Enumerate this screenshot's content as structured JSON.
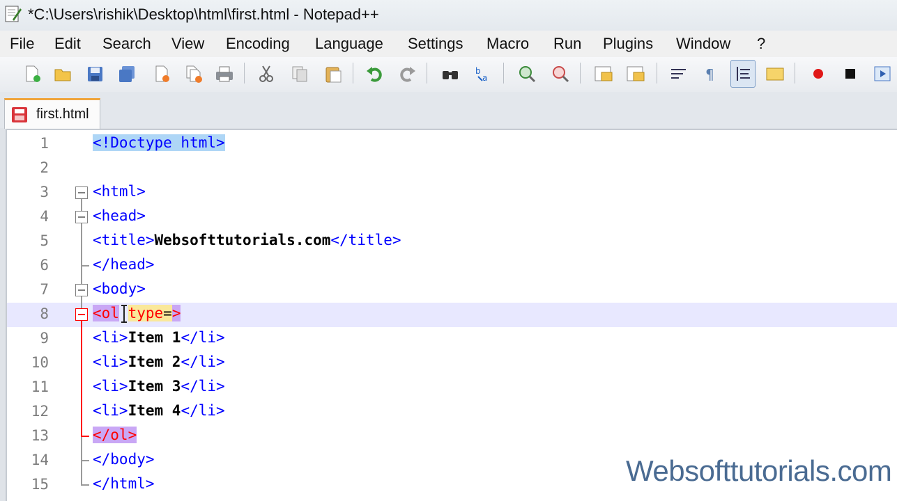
{
  "window": {
    "title": "*C:\\Users\\rishik\\Desktop\\html\\first.html - Notepad++"
  },
  "menu": [
    "File",
    "Edit",
    "Search",
    "View",
    "Encoding",
    "Language",
    "Settings",
    "Macro",
    "Run",
    "Plugins",
    "Window",
    "?"
  ],
  "tab": {
    "label": "first.html"
  },
  "editor": {
    "lines": [
      {
        "n": "1",
        "text": "<!Doctype html>"
      },
      {
        "n": "2",
        "text": ""
      },
      {
        "n": "3",
        "text": "<html>"
      },
      {
        "n": "4",
        "text": "<head>"
      },
      {
        "n": "5",
        "open": "<title>",
        "content": "Websofttutorials.com",
        "close": "</title>"
      },
      {
        "n": "6",
        "text": "</head>"
      },
      {
        "n": "7",
        "text": "<body>"
      },
      {
        "n": "8",
        "tag": "<ol",
        "attr": "type",
        "eq": "=",
        "end": ">"
      },
      {
        "n": "9",
        "open": "<li>",
        "content": "Item 1",
        "close": "</li>"
      },
      {
        "n": "10",
        "open": "<li>",
        "content": "Item 2",
        "close": "</li>"
      },
      {
        "n": "11",
        "open": "<li>",
        "content": "Item 3",
        "close": "</li>"
      },
      {
        "n": "12",
        "open": "<li>",
        "content": "Item 4",
        "close": "</li>"
      },
      {
        "n": "13",
        "text": "</ol>"
      },
      {
        "n": "14",
        "text": "</body>"
      },
      {
        "n": "15",
        "text": "</html>"
      }
    ]
  },
  "watermark": "Websofttutorials.com",
  "toolbar_icons": [
    "new-file-icon",
    "open-folder-icon",
    "save-icon",
    "save-all-icon",
    "close-icon",
    "close-all-icon",
    "print-icon",
    "cut-icon",
    "copy-icon",
    "paste-icon",
    "undo-icon",
    "redo-icon",
    "find-icon",
    "replace-icon",
    "zoom-in-icon",
    "zoom-out-icon",
    "sync-vertical-icon",
    "sync-horizontal-icon",
    "word-wrap-icon",
    "show-all-chars-icon",
    "indent-guide-icon",
    "user-lang-icon",
    "record-macro-icon",
    "stop-record-icon",
    "play-macro-icon"
  ],
  "colors": {
    "tag": "#0000ff",
    "attr": "#ff0000",
    "text": "#000000",
    "current_line": "#e8e8ff",
    "accent_tab": "#f0a53c"
  }
}
